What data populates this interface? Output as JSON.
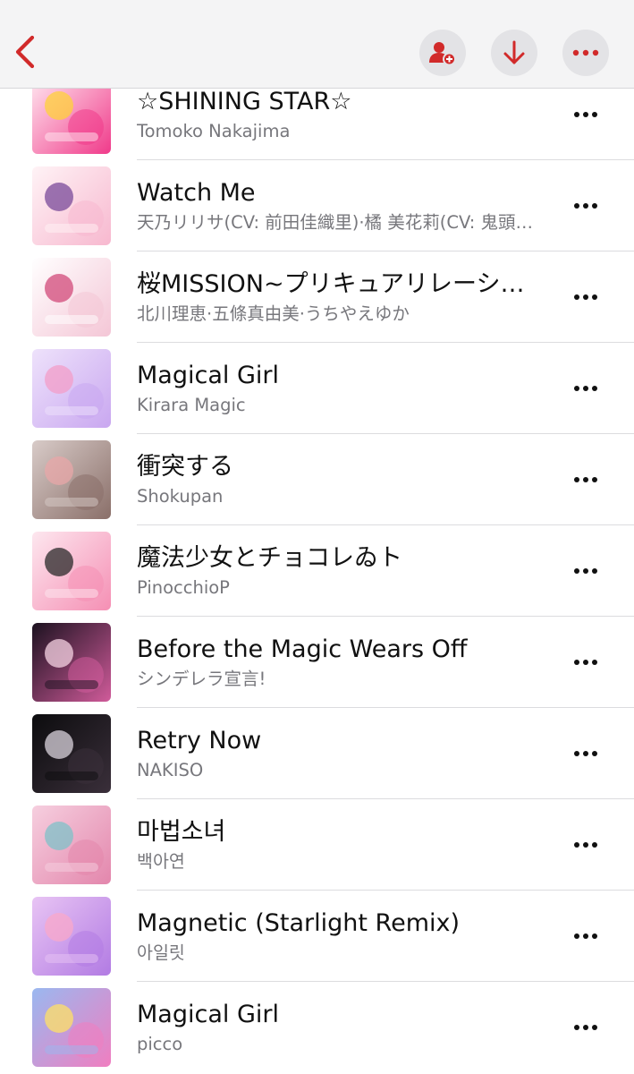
{
  "header": {
    "back_icon": "chevron-left-icon",
    "add_follower_icon": "person-plus-icon",
    "download_icon": "arrow-down-icon",
    "more_icon": "ellipsis-icon",
    "accent_color": "#d12a2a"
  },
  "songs": [
    {
      "title": "☆SHINING STAR☆",
      "artist": "Tomoko Nakajima",
      "art_colors": [
        "#ffe9f1",
        "#f03a8a",
        "#ffd23a"
      ]
    },
    {
      "title": "Watch Me",
      "artist": "天乃リリサ(CV: 前田佳織里)·橘 美花莉(CV: 鬼頭明里)",
      "art_colors": [
        "#fff3f6",
        "#f7b8cf",
        "#7a4a9a"
      ]
    },
    {
      "title": "桜MISSION~プリキュアリレーションシップ~",
      "artist": "北川理恵·五條真由美·うちやえゆか",
      "art_colors": [
        "#ffffff",
        "#f4c6d6",
        "#d24a7a"
      ]
    },
    {
      "title": "Magical Girl",
      "artist": "Kirara Magic",
      "art_colors": [
        "#eee2fb",
        "#c9a7f0",
        "#f39ec8"
      ]
    },
    {
      "title": "衝突する",
      "artist": "Shokupan",
      "art_colors": [
        "#d8cbc8",
        "#8a6f69",
        "#e8a7a8"
      ]
    },
    {
      "title": "魔法少女とチョコレゐト",
      "artist": "PinocchioP",
      "art_colors": [
        "#fde7ef",
        "#f58fb4",
        "#2a2a2a"
      ]
    },
    {
      "title": "Before the Magic Wears Off",
      "artist": "シンデレラ宣言!",
      "art_colors": [
        "#1c1220",
        "#d05b9a",
        "#f6d3e3"
      ]
    },
    {
      "title": "Retry Now",
      "artist": "NAKISO",
      "art_colors": [
        "#0c0c0e",
        "#3a2f3a",
        "#d9d3dc"
      ]
    },
    {
      "title": "마법소녀",
      "artist": "백아연",
      "art_colors": [
        "#f6cfdf",
        "#e386ac",
        "#7fc2c8"
      ]
    },
    {
      "title": "Magnetic (Starlight Remix)",
      "artist": "아일릿",
      "art_colors": [
        "#e8c4f4",
        "#b27be3",
        "#f9a8c9"
      ]
    },
    {
      "title": "Magical Girl",
      "artist": "picco",
      "art_colors": [
        "#9ab8f0",
        "#f07ec0",
        "#ffe066"
      ]
    }
  ]
}
